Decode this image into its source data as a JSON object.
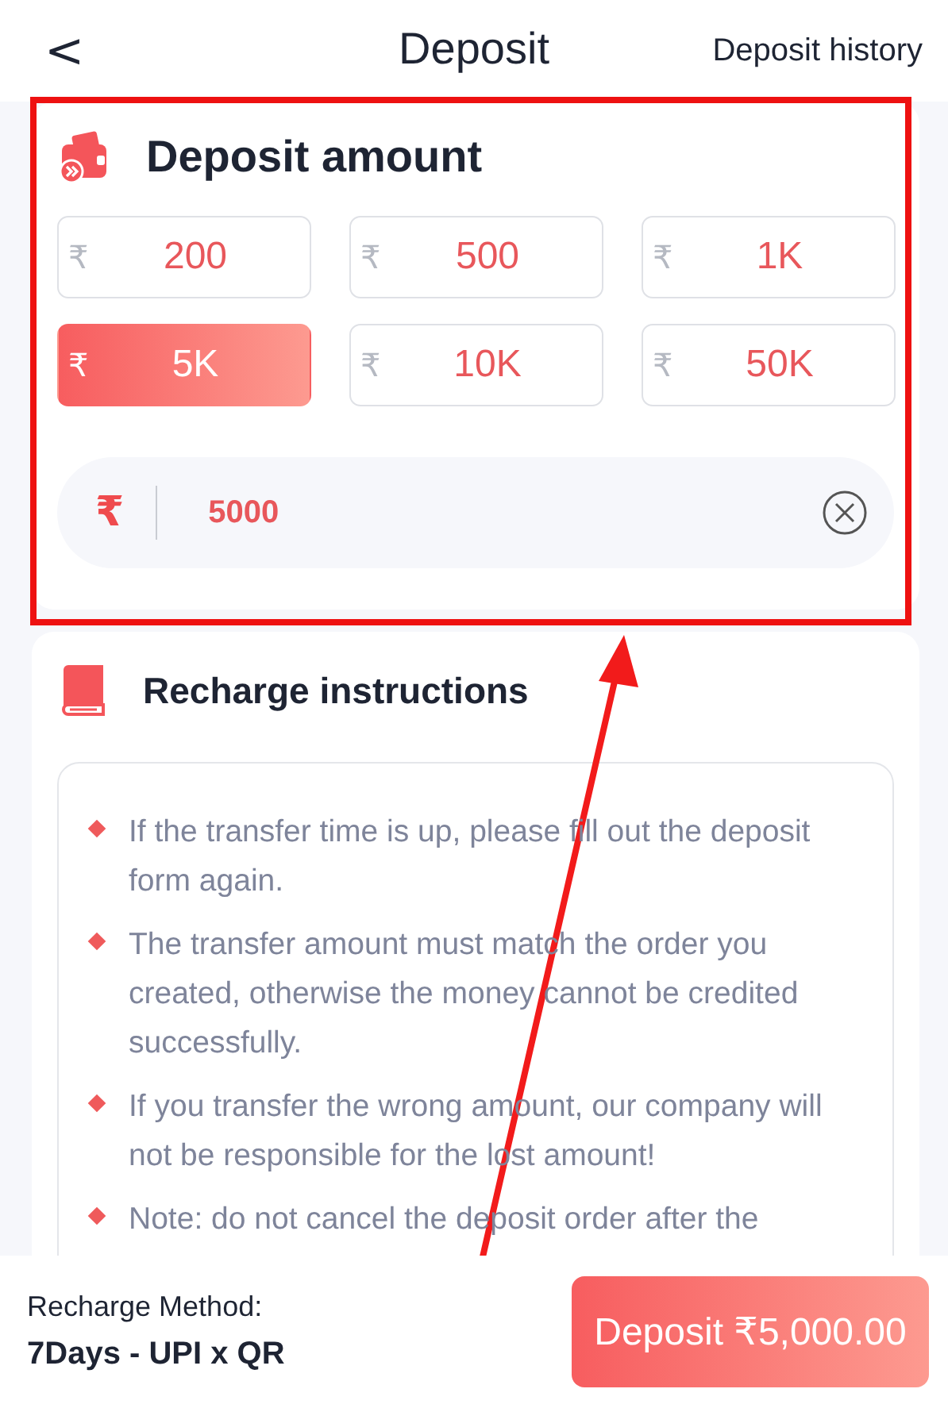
{
  "header": {
    "back": "<",
    "title": "Deposit",
    "link": "Deposit history"
  },
  "amount_card": {
    "title": "Deposit amount",
    "options": [
      {
        "currency": "₹",
        "label": "200",
        "selected": false
      },
      {
        "currency": "₹",
        "label": "500",
        "selected": false
      },
      {
        "currency": "₹",
        "label": "1K",
        "selected": false
      },
      {
        "currency": "₹",
        "label": "5K",
        "selected": true
      },
      {
        "currency": "₹",
        "label": "10K",
        "selected": false
      },
      {
        "currency": "₹",
        "label": "50K",
        "selected": false
      }
    ],
    "input": {
      "currency": "₹",
      "value": "5000"
    }
  },
  "instructions": {
    "title": "Recharge instructions",
    "items": [
      "If the transfer time is up, please fill out the deposit form again.",
      "The transfer amount must match the order you created, otherwise the money cannot be credited successfully.",
      "If you transfer the wrong amount, our company will not be responsible for the lost amount!",
      "Note: do not cancel the deposit order after the"
    ]
  },
  "footer": {
    "method_label": "Recharge Method:",
    "method": "7Days - UPI x QR",
    "button": "Deposit ₹5,000.00"
  }
}
